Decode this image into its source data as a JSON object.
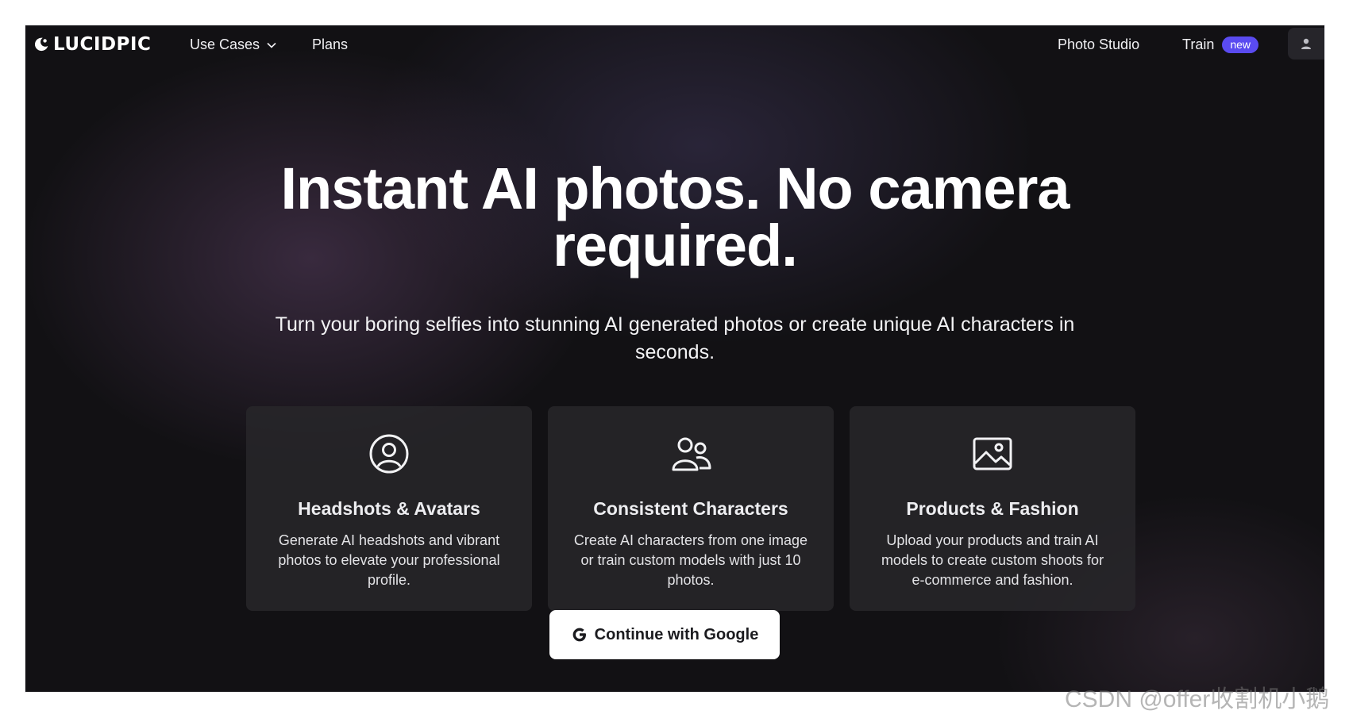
{
  "nav": {
    "brand": "LUCIDPIC",
    "use_cases": "Use Cases",
    "plans": "Plans",
    "photo_studio": "Photo Studio",
    "train": "Train",
    "train_badge": "new",
    "icons": {
      "logo": "moon-logo-icon",
      "dropdown": "chevron-down-icon",
      "account": "user-icon"
    }
  },
  "hero": {
    "title_line1": "Instant AI photos. No camera",
    "title_line2": "required.",
    "subtitle": "Turn your boring selfies into stunning AI generated photos or create unique AI characters in seconds."
  },
  "cards": [
    {
      "icon": "user-circle-icon",
      "title": "Headshots & Avatars",
      "description": "Generate AI headshots and vibrant photos to elevate your professional profile."
    },
    {
      "icon": "users-icon",
      "title": "Consistent Characters",
      "description": "Create AI characters from one image or train custom models with just 10 photos."
    },
    {
      "icon": "image-icon",
      "title": "Products & Fashion",
      "description": "Upload your products and train AI models to create custom shoots for e-commerce and fashion."
    }
  ],
  "cta": {
    "label": "Continue with Google",
    "icon": "google-g-icon"
  },
  "watermark": "CSDN @offer收割机小鹅",
  "colors": {
    "background": "#121114",
    "badge": "#5a4bf0",
    "card": "#28272b",
    "button": "#ffffff"
  }
}
